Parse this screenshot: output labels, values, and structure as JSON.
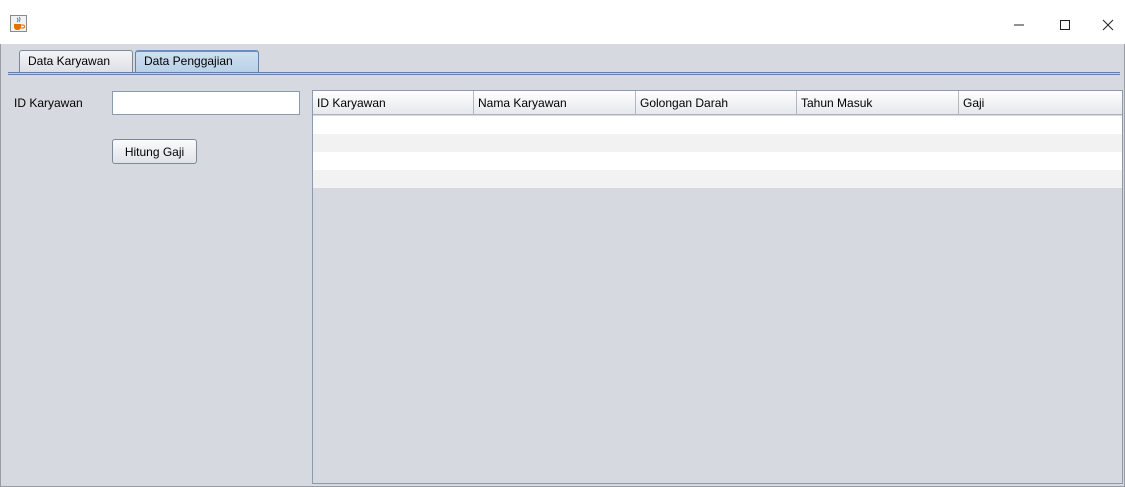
{
  "window": {
    "title": "",
    "icon": "java-cup-icon",
    "controls": {
      "minimize": "—",
      "maximize": "☐",
      "close": "✕"
    }
  },
  "tabs": [
    {
      "label": "Data Karyawan",
      "selected": false
    },
    {
      "label": "Data Penggajian",
      "selected": true
    }
  ],
  "form": {
    "id_label": "ID Karyawan",
    "id_value": "",
    "hitung_button": "Hitung Gaji"
  },
  "table": {
    "columns": [
      "ID Karyawan",
      "Nama Karyawan",
      "Golongan Darah",
      "Tahun Masuk",
      "Gaji"
    ],
    "rows": [
      [
        "",
        "",
        "",
        "",
        ""
      ],
      [
        "",
        "",
        "",
        "",
        ""
      ],
      [
        "",
        "",
        "",
        "",
        ""
      ],
      [
        "",
        "",
        "",
        "",
        ""
      ]
    ]
  },
  "colors": {
    "background": "#d6d9df",
    "selected_tab": "#b8d0e8",
    "row_alt": "#f2f2f2"
  }
}
